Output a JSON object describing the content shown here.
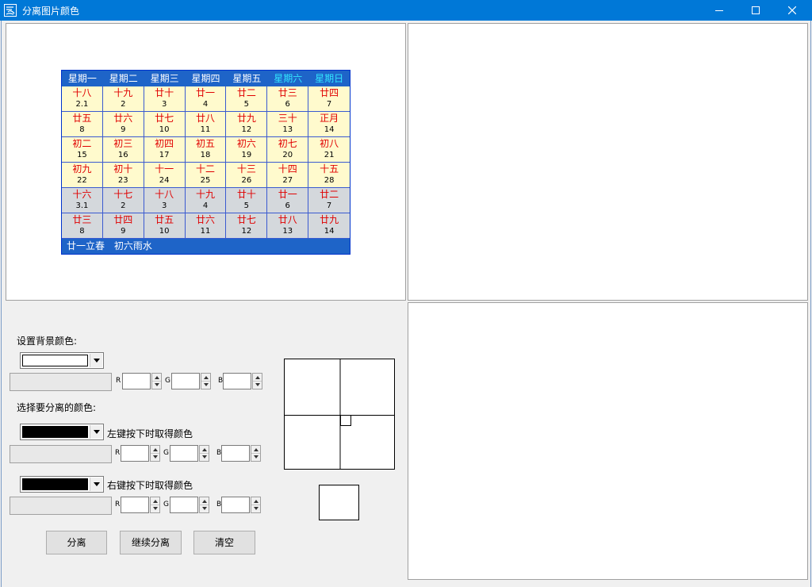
{
  "window": {
    "title": "分离图片颜色",
    "title_bar_color": "#0078d7",
    "icon": "app-logo-icon",
    "controls": [
      "minimize-icon",
      "maximize-icon",
      "close-icon"
    ]
  },
  "calendar": {
    "weekdays": [
      "星期一",
      "星期二",
      "星期三",
      "星期四",
      "星期五",
      "星期六",
      "星期日"
    ],
    "rows": [
      {
        "grey": false,
        "cells": [
          [
            "十八",
            "2.1"
          ],
          [
            "十九",
            "2"
          ],
          [
            "廿十",
            "3"
          ],
          [
            "廿一",
            "4"
          ],
          [
            "廿二",
            "5"
          ],
          [
            "廿三",
            "6"
          ],
          [
            "廿四",
            "7"
          ]
        ]
      },
      {
        "grey": false,
        "cells": [
          [
            "廿五",
            "8"
          ],
          [
            "廿六",
            "9"
          ],
          [
            "廿七",
            "10"
          ],
          [
            "廿八",
            "11"
          ],
          [
            "廿九",
            "12"
          ],
          [
            "三十",
            "13"
          ],
          [
            "正月",
            "14"
          ]
        ]
      },
      {
        "grey": false,
        "cells": [
          [
            "初二",
            "15"
          ],
          [
            "初三",
            "16"
          ],
          [
            "初四",
            "17"
          ],
          [
            "初五",
            "18"
          ],
          [
            "初六",
            "19"
          ],
          [
            "初七",
            "20"
          ],
          [
            "初八",
            "21"
          ]
        ]
      },
      {
        "grey": false,
        "cells": [
          [
            "初九",
            "22"
          ],
          [
            "初十",
            "23"
          ],
          [
            "十一",
            "24"
          ],
          [
            "十二",
            "25"
          ],
          [
            "十三",
            "26"
          ],
          [
            "十四",
            "27"
          ],
          [
            "十五",
            "28"
          ]
        ]
      },
      {
        "grey": true,
        "cells": [
          [
            "十六",
            "3.1"
          ],
          [
            "十七",
            "2"
          ],
          [
            "十八",
            "3"
          ],
          [
            "十九",
            "4"
          ],
          [
            "廿十",
            "5"
          ],
          [
            "廿一",
            "6"
          ],
          [
            "廿二",
            "7"
          ]
        ]
      },
      {
        "grey": true,
        "cells": [
          [
            "廿三",
            "8"
          ],
          [
            "廿四",
            "9"
          ],
          [
            "廿五",
            "10"
          ],
          [
            "廿六",
            "11"
          ],
          [
            "廿七",
            "12"
          ],
          [
            "廿八",
            "13"
          ],
          [
            "廿九",
            "14"
          ]
        ]
      }
    ],
    "footer": "廿一立春 初六雨水",
    "colors": {
      "header": "#1e64c8",
      "weekend_text": "#32e6ff",
      "lunar_text": "#e00000",
      "cell_bg": "#fffacd",
      "grey_bg": "#d4d8dc"
    }
  },
  "controls": {
    "bg_label": "设置背景颜色:",
    "bg_color": "#ffffff",
    "select_label": "选择要分离的颜色:",
    "left_label": "左键按下时取得颜色",
    "left_color": "#000000",
    "right_label": "右键按下时取得颜色",
    "right_color": "#000000",
    "rgb": {
      "r": "R",
      "g": "G",
      "b": "B"
    },
    "buttons": {
      "separate": "分离",
      "continue": "继续分离",
      "clear": "清空"
    }
  }
}
